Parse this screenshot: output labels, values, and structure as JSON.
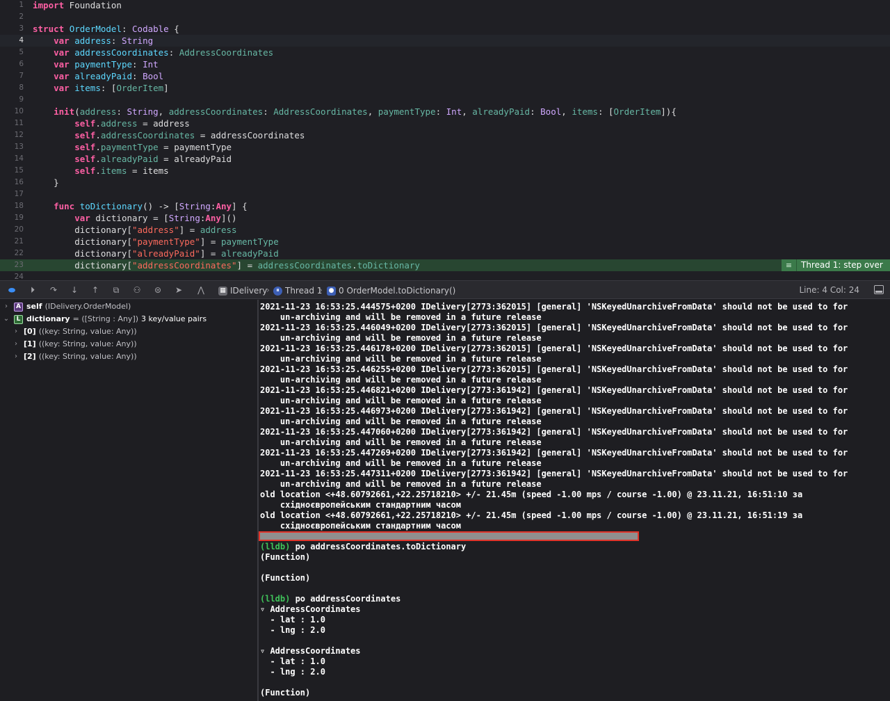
{
  "editor": {
    "lines": [
      {
        "n": "1",
        "tokens": [
          [
            "kw",
            "import"
          ],
          [
            "tx",
            " Foundation"
          ]
        ]
      },
      {
        "n": "2",
        "tokens": []
      },
      {
        "n": "3",
        "tokens": [
          [
            "kw",
            "struct"
          ],
          [
            "tx",
            " "
          ],
          [
            "nt",
            "OrderModel"
          ],
          [
            "tx",
            ": "
          ],
          [
            "ty",
            "Codable"
          ],
          [
            "tx",
            " {"
          ]
        ]
      },
      {
        "n": "4",
        "current": true,
        "tokens": [
          [
            "tx",
            "    "
          ],
          [
            "kw",
            "var"
          ],
          [
            "tx",
            " "
          ],
          [
            "nt",
            "address"
          ],
          [
            "tx",
            ": "
          ],
          [
            "ty",
            "String"
          ]
        ]
      },
      {
        "n": "5",
        "tokens": [
          [
            "tx",
            "    "
          ],
          [
            "kw",
            "var"
          ],
          [
            "tx",
            " "
          ],
          [
            "nt",
            "addressCoordinates"
          ],
          [
            "tx",
            ": "
          ],
          [
            "pr",
            "AddressCoordinates"
          ]
        ]
      },
      {
        "n": "6",
        "tokens": [
          [
            "tx",
            "    "
          ],
          [
            "kw",
            "var"
          ],
          [
            "tx",
            " "
          ],
          [
            "nt",
            "paymentType"
          ],
          [
            "tx",
            ": "
          ],
          [
            "ty",
            "Int"
          ]
        ]
      },
      {
        "n": "7",
        "tokens": [
          [
            "tx",
            "    "
          ],
          [
            "kw",
            "var"
          ],
          [
            "tx",
            " "
          ],
          [
            "nt",
            "alreadyPaid"
          ],
          [
            "tx",
            ": "
          ],
          [
            "ty",
            "Bool"
          ]
        ]
      },
      {
        "n": "8",
        "tokens": [
          [
            "tx",
            "    "
          ],
          [
            "kw",
            "var"
          ],
          [
            "tx",
            " "
          ],
          [
            "nt",
            "items"
          ],
          [
            "tx",
            ": ["
          ],
          [
            "pr",
            "OrderItem"
          ],
          [
            "tx",
            "]"
          ]
        ]
      },
      {
        "n": "9",
        "tokens": []
      },
      {
        "n": "10",
        "tokens": [
          [
            "tx",
            "    "
          ],
          [
            "kw",
            "init"
          ],
          [
            "tx",
            "("
          ],
          [
            "fn",
            "address"
          ],
          [
            "tx",
            ": "
          ],
          [
            "ty",
            "String"
          ],
          [
            "tx",
            ", "
          ],
          [
            "fn",
            "addressCoordinates"
          ],
          [
            "tx",
            ": "
          ],
          [
            "pr",
            "AddressCoordinates"
          ],
          [
            "tx",
            ", "
          ],
          [
            "fn",
            "paymentType"
          ],
          [
            "tx",
            ": "
          ],
          [
            "ty",
            "Int"
          ],
          [
            "tx",
            ", "
          ],
          [
            "fn",
            "alreadyPaid"
          ],
          [
            "tx",
            ": "
          ],
          [
            "ty",
            "Bool"
          ],
          [
            "tx",
            ", "
          ],
          [
            "fn",
            "items"
          ],
          [
            "tx",
            ": ["
          ],
          [
            "pr",
            "OrderItem"
          ],
          [
            "tx",
            "]){"
          ]
        ]
      },
      {
        "n": "11",
        "tokens": [
          [
            "tx",
            "        "
          ],
          [
            "kw",
            "self"
          ],
          [
            "tx",
            "."
          ],
          [
            "pr",
            "address"
          ],
          [
            "tx",
            " = address"
          ]
        ]
      },
      {
        "n": "12",
        "tokens": [
          [
            "tx",
            "        "
          ],
          [
            "kw",
            "self"
          ],
          [
            "tx",
            "."
          ],
          [
            "pr",
            "addressCoordinates"
          ],
          [
            "tx",
            " = addressCoordinates"
          ]
        ]
      },
      {
        "n": "13",
        "tokens": [
          [
            "tx",
            "        "
          ],
          [
            "kw",
            "self"
          ],
          [
            "tx",
            "."
          ],
          [
            "pr",
            "paymentType"
          ],
          [
            "tx",
            " = paymentType"
          ]
        ]
      },
      {
        "n": "14",
        "tokens": [
          [
            "tx",
            "        "
          ],
          [
            "kw",
            "self"
          ],
          [
            "tx",
            "."
          ],
          [
            "pr",
            "alreadyPaid"
          ],
          [
            "tx",
            " = alreadyPaid"
          ]
        ]
      },
      {
        "n": "15",
        "tokens": [
          [
            "tx",
            "        "
          ],
          [
            "kw",
            "self"
          ],
          [
            "tx",
            "."
          ],
          [
            "pr",
            "items"
          ],
          [
            "tx",
            " = items"
          ]
        ]
      },
      {
        "n": "16",
        "tokens": [
          [
            "tx",
            "    }"
          ]
        ]
      },
      {
        "n": "17",
        "tokens": []
      },
      {
        "n": "18",
        "tokens": [
          [
            "tx",
            "    "
          ],
          [
            "kw",
            "func"
          ],
          [
            "tx",
            " "
          ],
          [
            "nt",
            "toDictionary"
          ],
          [
            "tx",
            "() -> ["
          ],
          [
            "ty",
            "String"
          ],
          [
            "tx",
            ":"
          ],
          [
            "kw",
            "Any"
          ],
          [
            "tx",
            "] {"
          ]
        ]
      },
      {
        "n": "19",
        "tokens": [
          [
            "tx",
            "        "
          ],
          [
            "kw",
            "var"
          ],
          [
            "tx",
            " dictionary = ["
          ],
          [
            "ty",
            "String"
          ],
          [
            "tx",
            ":"
          ],
          [
            "kw",
            "Any"
          ],
          [
            "tx",
            "]()"
          ]
        ]
      },
      {
        "n": "20",
        "tokens": [
          [
            "tx",
            "        dictionary["
          ],
          [
            "st",
            "\"address\""
          ],
          [
            "tx",
            "] = "
          ],
          [
            "pr",
            "address"
          ]
        ]
      },
      {
        "n": "21",
        "tokens": [
          [
            "tx",
            "        dictionary["
          ],
          [
            "st",
            "\"paymentType\""
          ],
          [
            "tx",
            "] = "
          ],
          [
            "pr",
            "paymentType"
          ]
        ]
      },
      {
        "n": "22",
        "tokens": [
          [
            "tx",
            "        dictionary["
          ],
          [
            "st",
            "\"alreadyPaid\""
          ],
          [
            "tx",
            "] = "
          ],
          [
            "pr",
            "alreadyPaid"
          ]
        ]
      },
      {
        "n": "23",
        "exec": true,
        "tokens": [
          [
            "tx",
            "        dictionary["
          ],
          [
            "st",
            "\"addressCoordinates\""
          ],
          [
            "tx",
            "] = "
          ],
          [
            "pr",
            "addressCoordinates"
          ],
          [
            "tx",
            "."
          ],
          [
            "pr",
            "toDictionary"
          ]
        ]
      },
      {
        "n": "24",
        "tokens": []
      }
    ],
    "thread_badge": "Thread 1: step over",
    "thread_badge_icon": "≡"
  },
  "debug_bar": {
    "scheme": "IDelivery",
    "thread": "Thread 1",
    "frame": "0 OrderModel.toDictionary()",
    "line_col": "Line: 4  Col: 24",
    "accent": "#3a8ef6"
  },
  "variables": [
    {
      "disc": "›",
      "kind": "A",
      "name": "self",
      "type": "(IDelivery.OrderModel)",
      "value": "",
      "indent": 0
    },
    {
      "disc": "⌄",
      "kind": "L",
      "name": "dictionary",
      "type": "= ([String : Any])",
      "value": "3 key/value pairs",
      "indent": 0
    },
    {
      "disc": "›",
      "kind": "",
      "name": "[0]",
      "type": "((key: String, value: Any))",
      "value": "",
      "indent": 1
    },
    {
      "disc": "›",
      "kind": "",
      "name": "[1]",
      "type": "((key: String, value: Any))",
      "value": "",
      "indent": 1
    },
    {
      "disc": "›",
      "kind": "",
      "name": "[2]",
      "type": "((key: String, value: Any))",
      "value": "",
      "indent": 1
    }
  ],
  "console": {
    "lines": [
      {
        "t": "2021-11-23 16:53:25.444575+0200 IDelivery[2773:362015] [general] 'NSKeyedUnarchiveFromData' should not be used to for"
      },
      {
        "t": "    un-archiving and will be removed in a future release"
      },
      {
        "t": "2021-11-23 16:53:25.446049+0200 IDelivery[2773:362015] [general] 'NSKeyedUnarchiveFromData' should not be used to for"
      },
      {
        "t": "    un-archiving and will be removed in a future release"
      },
      {
        "t": "2021-11-23 16:53:25.446178+0200 IDelivery[2773:362015] [general] 'NSKeyedUnarchiveFromData' should not be used to for"
      },
      {
        "t": "    un-archiving and will be removed in a future release"
      },
      {
        "t": "2021-11-23 16:53:25.446255+0200 IDelivery[2773:362015] [general] 'NSKeyedUnarchiveFromData' should not be used to for"
      },
      {
        "t": "    un-archiving and will be removed in a future release"
      },
      {
        "t": "2021-11-23 16:53:25.446821+0200 IDelivery[2773:361942] [general] 'NSKeyedUnarchiveFromData' should not be used to for"
      },
      {
        "t": "    un-archiving and will be removed in a future release"
      },
      {
        "t": "2021-11-23 16:53:25.446973+0200 IDelivery[2773:361942] [general] 'NSKeyedUnarchiveFromData' should not be used to for"
      },
      {
        "t": "    un-archiving and will be removed in a future release"
      },
      {
        "t": "2021-11-23 16:53:25.447060+0200 IDelivery[2773:361942] [general] 'NSKeyedUnarchiveFromData' should not be used to for"
      },
      {
        "t": "    un-archiving and will be removed in a future release"
      },
      {
        "t": "2021-11-23 16:53:25.447269+0200 IDelivery[2773:361942] [general] 'NSKeyedUnarchiveFromData' should not be used to for"
      },
      {
        "t": "    un-archiving and will be removed in a future release"
      },
      {
        "t": "2021-11-23 16:53:25.447311+0200 IDelivery[2773:361942] [general] 'NSKeyedUnarchiveFromData' should not be used to for"
      },
      {
        "t": "    un-archiving and will be removed in a future release"
      },
      {
        "t": "old location <+48.60792661,+22.25718210> +/- 21.45m (speed -1.00 mps / course -1.00) @ 23.11.21, 16:51:10 за"
      },
      {
        "t": "    східноєвропейським стандартним часом"
      },
      {
        "t": "old location <+48.60792661,+22.25718210> +/- 21.45m (speed -1.00 mps / course -1.00) @ 23.11.21, 16:51:19 за"
      },
      {
        "t": "    східноєвропейським стандартним часом"
      },
      {
        "t": "",
        "gap": true
      },
      {
        "p": "(lldb)",
        "t": " po addressCoordinates.toDictionary"
      },
      {
        "t": "(Function)"
      },
      {
        "t": ""
      },
      {
        "t": "(Function)"
      },
      {
        "t": ""
      },
      {
        "p": "(lldb)",
        "t": " po addressCoordinates"
      },
      {
        "t": "▿ AddressCoordinates"
      },
      {
        "t": "  - lat : 1.0"
      },
      {
        "t": "  - lng : 2.0"
      },
      {
        "t": ""
      },
      {
        "t": "▿ AddressCoordinates"
      },
      {
        "t": "  - lat : 1.0"
      },
      {
        "t": "  - lng : 2.0"
      },
      {
        "t": ""
      },
      {
        "t": "(Function)"
      }
    ],
    "prompt_color": "#3fc35a"
  }
}
